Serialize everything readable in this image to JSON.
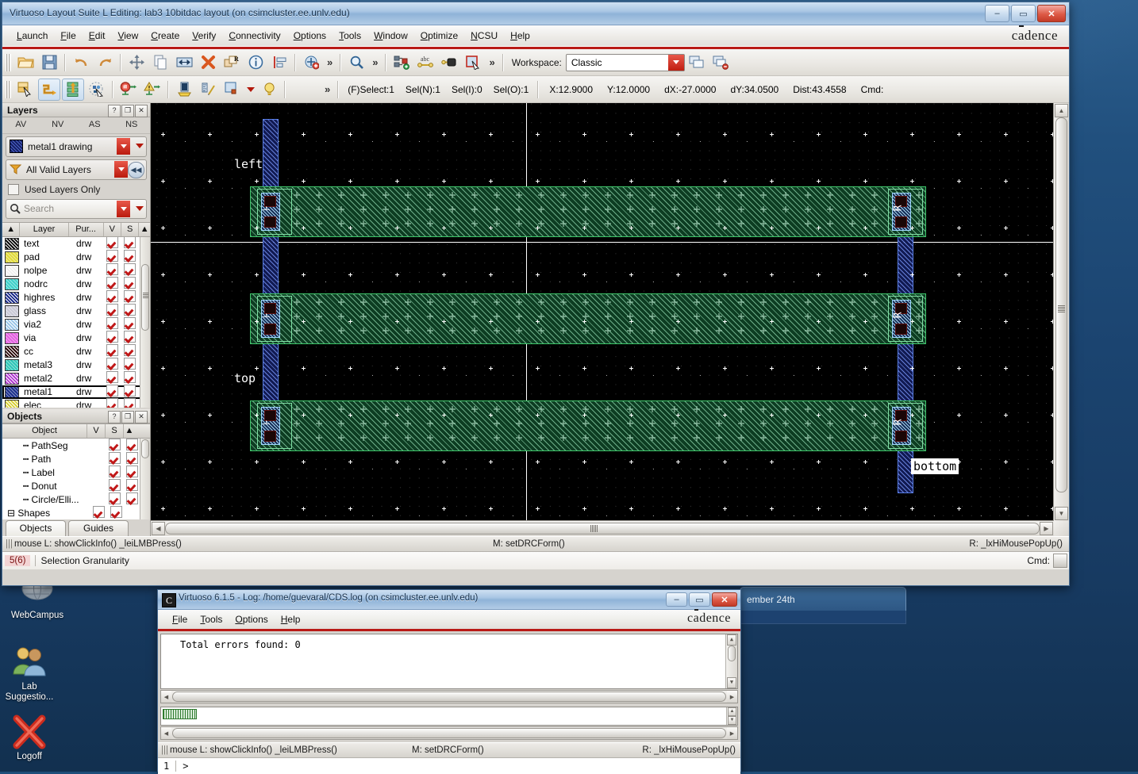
{
  "desktop": {
    "icons": [
      {
        "name": "webcampus",
        "label": "WebCampus",
        "glyph": "globe"
      },
      {
        "name": "lab-suggestions",
        "label": "Lab\nSuggestio...",
        "glyph": "users"
      },
      {
        "name": "logoff",
        "label": "Logoff",
        "glyph": "red-x"
      }
    ],
    "background_window_text": "ember 24th"
  },
  "main_window": {
    "title": "Virtuoso Layout Suite L Editing: lab3 10bitdac layout (on csimcluster.ee.unlv.edu)",
    "brand": "cadence",
    "window_controls": {
      "minimize": "–",
      "maximize": "▭",
      "close": "✕"
    },
    "menus": [
      "Launch",
      "File",
      "Edit",
      "View",
      "Create",
      "Verify",
      "Connectivity",
      "Options",
      "Tools",
      "Window",
      "Optimize",
      "NCSU",
      "Help"
    ],
    "toolbar1": [
      {
        "name": "open-icon",
        "glyph": "folder"
      },
      {
        "name": "save-icon",
        "glyph": "floppy"
      },
      {
        "name": "undo-icon",
        "glyph": "undo"
      },
      {
        "name": "redo-icon",
        "glyph": "redo"
      },
      {
        "name": "move-icon",
        "glyph": "move"
      },
      {
        "name": "copy-icon",
        "glyph": "copy"
      },
      {
        "name": "stretch-icon",
        "glyph": "stretch"
      },
      {
        "name": "delete-icon",
        "glyph": "delete-x"
      },
      {
        "name": "rotate-icon",
        "glyph": "rotate-r"
      },
      {
        "name": "properties-icon",
        "glyph": "info"
      },
      {
        "name": "align-icon",
        "glyph": "align"
      },
      {
        "name": "instance-icon",
        "glyph": "instance"
      },
      {
        "name": "zoom-icon",
        "glyph": "magnifier"
      },
      {
        "name": "create-pin-icon",
        "glyph": "pin"
      },
      {
        "name": "create-label-icon",
        "glyph": "abc"
      },
      {
        "name": "create-via-icon",
        "glyph": "via"
      },
      {
        "name": "create-rect-icon",
        "glyph": "rect-cursor"
      }
    ],
    "toolbar2": [
      {
        "name": "partial-select-icon",
        "glyph": "partial-select"
      },
      {
        "name": "flight-line-icon",
        "glyph": "flightline",
        "active": true
      },
      {
        "name": "net-highlight-icon",
        "glyph": "nethighlight",
        "active": true
      },
      {
        "name": "show-select-icon",
        "glyph": "showselect"
      },
      {
        "name": "stop-icon",
        "glyph": "stop-hand"
      },
      {
        "name": "warning-icon",
        "glyph": "warning"
      },
      {
        "name": "ruler-icon",
        "glyph": "ruler-tool"
      },
      {
        "name": "measure-icon",
        "glyph": "measure"
      },
      {
        "name": "display-options-icon",
        "glyph": "display-opts"
      },
      {
        "name": "lightbulb-icon",
        "glyph": "bulb"
      }
    ],
    "workspace": {
      "label": "Workspace:",
      "value": "Classic"
    },
    "status": {
      "select_mode": "(F)Select:1",
      "sel_n": "Sel(N):1",
      "sel_i": "Sel(I):0",
      "sel_o": "Sel(O):1",
      "x": "X:12.9000",
      "y": "Y:12.0000",
      "dx": "dX:-27.0000",
      "dy": "dY:34.0500",
      "dist": "Dist:43.4558",
      "cmd": "Cmd:"
    },
    "layers_panel": {
      "title": "Layers",
      "buttons": {
        "help": "?",
        "float": "❐",
        "close": "✕"
      },
      "columns_top": [
        "AV",
        "NV",
        "AS",
        "NS"
      ],
      "selected_layer": "metal1 drawing",
      "filter": "All Valid Layers",
      "used_layers_only": "Used Layers Only",
      "search_placeholder": "Search",
      "table_headers": [
        "Layer",
        "Pur...",
        "V",
        "S"
      ],
      "rows": [
        {
          "layer": "elec",
          "purpose": "drw",
          "v": true,
          "s": true,
          "color": "#d9d13a",
          "selected": false
        },
        {
          "layer": "metal1",
          "purpose": "drw",
          "v": true,
          "s": true,
          "color": "#1b2f8c",
          "selected": true
        },
        {
          "layer": "metal2",
          "purpose": "drw",
          "v": true,
          "s": true,
          "color": "#b23ad1",
          "selected": false
        },
        {
          "layer": "metal3",
          "purpose": "drw",
          "v": true,
          "s": true,
          "color": "#2fc6b7",
          "selected": false
        },
        {
          "layer": "cc",
          "purpose": "drw",
          "v": true,
          "s": true,
          "color": "#2b0a0a",
          "selected": false
        },
        {
          "layer": "via",
          "purpose": "drw",
          "v": true,
          "s": true,
          "color": "#e45fe0",
          "selected": false
        },
        {
          "layer": "via2",
          "purpose": "drw",
          "v": true,
          "s": true,
          "color": "#9ac6e8",
          "selected": false
        },
        {
          "layer": "glass",
          "purpose": "drw",
          "v": true,
          "s": true,
          "color": "#c9c9d6",
          "selected": false
        },
        {
          "layer": "highres",
          "purpose": "drw",
          "v": true,
          "s": true,
          "color": "#1a2a8a",
          "selected": false
        },
        {
          "layer": "nodrc",
          "purpose": "drw",
          "v": true,
          "s": true,
          "color": "#3ed0c9",
          "selected": false
        },
        {
          "layer": "nolpe",
          "purpose": "drw",
          "v": true,
          "s": true,
          "color": "#efefef",
          "selected": false
        },
        {
          "layer": "pad",
          "purpose": "drw",
          "v": true,
          "s": true,
          "color": "#e0da3a",
          "selected": false
        },
        {
          "layer": "text",
          "purpose": "drw",
          "v": true,
          "s": true,
          "color": "#0b0b0b",
          "selected": false
        }
      ]
    },
    "objects_panel": {
      "title": "Objects",
      "buttons": {
        "help": "?",
        "float": "❐",
        "close": "✕"
      },
      "table_headers": [
        "Object",
        "V",
        "S"
      ],
      "rows": [
        {
          "label": "Shapes",
          "indent": 0,
          "expander": "⊟",
          "v": true,
          "s": true
        },
        {
          "label": "Circle/Elli...",
          "indent": 1,
          "v": true,
          "s": true
        },
        {
          "label": "Donut",
          "indent": 1,
          "v": true,
          "s": true
        },
        {
          "label": "Label",
          "indent": 1,
          "v": true,
          "s": true
        },
        {
          "label": "Path",
          "indent": 1,
          "v": true,
          "s": true
        },
        {
          "label": "PathSeg",
          "indent": 1,
          "v": true,
          "s": true
        }
      ],
      "tabs": [
        {
          "label": "Objects",
          "active": true
        },
        {
          "label": "Guides",
          "active": false
        }
      ]
    },
    "mouse_bar": {
      "left": "mouse L: showClickInfo() _leiLMBPress()",
      "middle": "M: setDRCForm()",
      "right": "R: _lxHiMousePopUp()"
    },
    "bottom_bar": {
      "granularity_level": "5(6)",
      "granularity_label": "Selection Granularity",
      "cmd_label": "Cmd:"
    },
    "canvas": {
      "labels": [
        {
          "name": "label-left",
          "text": "left",
          "selected": false
        },
        {
          "name": "label-top",
          "text": "top",
          "selected": false
        },
        {
          "name": "label-bottom",
          "text": "bottom",
          "selected": true
        }
      ],
      "instance_marks": [
        "R",
        "R",
        "R"
      ]
    }
  },
  "log_window": {
    "title": "Virtuoso 6.1.5 - Log: /home/guevaral/CDS.log (on csimcluster.ee.unlv.edu)",
    "icon_letter": "C",
    "brand": "cadence",
    "window_controls": {
      "minimize": "–",
      "maximize": "▭",
      "close": "✕"
    },
    "menus": [
      "File",
      "Tools",
      "Options",
      "Help"
    ],
    "log_text": "Total errors found: 0",
    "mouse_bar": {
      "left": "mouse L: showClickInfo() _leiLMBPress()",
      "middle": "M: setDRCForm()",
      "right": "R: _lxHiMousePopUp()"
    },
    "cmd_line": {
      "number": "1",
      "prompt": ">"
    }
  }
}
